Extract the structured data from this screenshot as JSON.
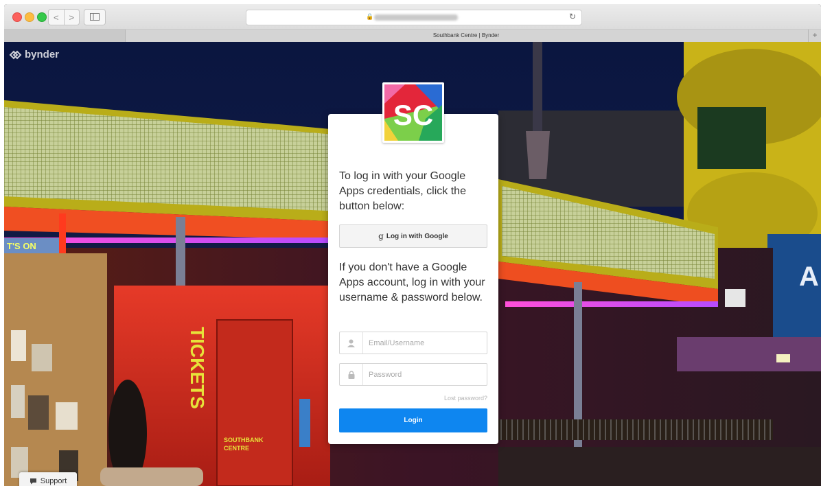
{
  "browser": {
    "tab_title": "Southbank Centre | Bynder",
    "new_tab_label": "+",
    "back_glyph": "<",
    "forward_glyph": ">",
    "reload_glyph": "↻"
  },
  "brand": {
    "name": "bynder",
    "icon": "bynder-logo-icon"
  },
  "scene": {
    "sign_tickets": "TICKETS",
    "sign_whats_on": "T'S ON",
    "sign_southbank": "SOUTHBANK",
    "sign_centre": "CENTRE",
    "sign_fragment": "A"
  },
  "login": {
    "logo_text": "SC",
    "google_intro": "To log in with your Google Apps credentials, click the button below:",
    "google_button_glyph": "g",
    "google_button_label": "Log in with Google",
    "password_intro": "If you don't have a Google Apps account, log in with your username & password below.",
    "email_placeholder": "Email/Username",
    "email_value": "",
    "password_placeholder": "Password",
    "password_value": "",
    "lost_password": "Lost password?",
    "login_button": "Login",
    "accent_color": "#0e86f0"
  },
  "support": {
    "label": "Support",
    "icon": "chat-bubble-icon"
  }
}
